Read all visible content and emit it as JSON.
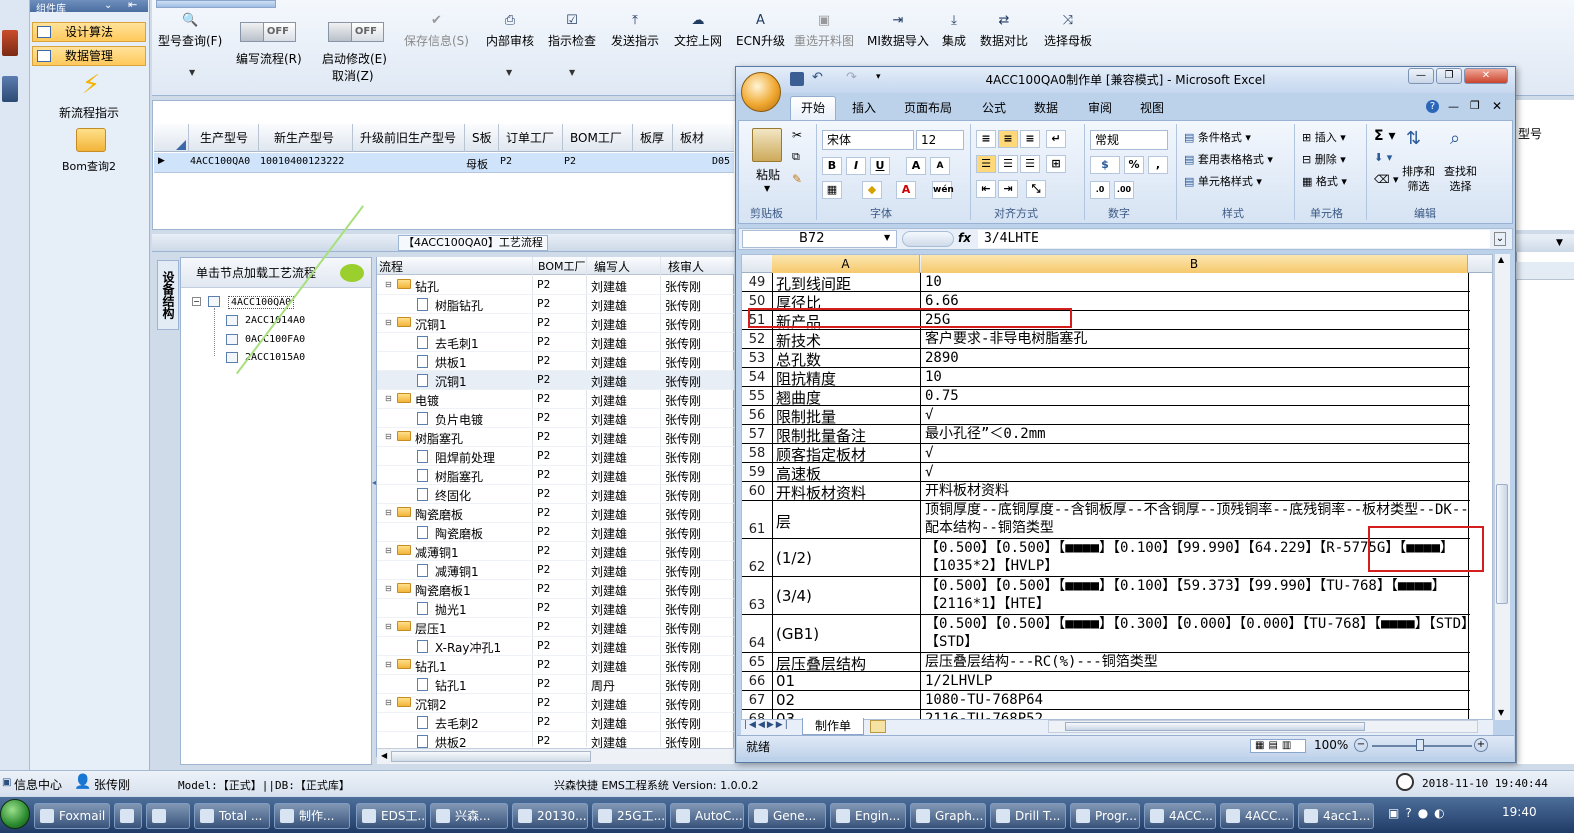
{
  "left_nav": {
    "header": "组件库",
    "items": [
      "设计算法",
      "数据管理"
    ],
    "new_flow": "新流程指示",
    "bom_query": "Bom查询2"
  },
  "toolbar": {
    "model_query": "型号查询(F)",
    "edit_flow": "编写流程(R)",
    "edit_flow_toggle": "OFF",
    "enable_edit": "启动修改(E)",
    "enable_edit_toggle": "OFF",
    "cancel": "取消(Z)",
    "save": "保存信息(S)",
    "internal_review": "内部审核",
    "check": "指示检查",
    "send": "发送指示",
    "upload": "文控上网",
    "ecn": "ECN升级",
    "reissue": "重选开料图",
    "mi_import": "MI数据导入",
    "integrate": "集成",
    "compare": "数据对比",
    "choose_mother": "选择母板"
  },
  "top_grid": {
    "headers": [
      "生产型号",
      "新生产型号",
      "升级前旧生产型号",
      "S板",
      "订单工厂",
      "BOM工厂",
      "板厚",
      "板材"
    ],
    "row": [
      "4ACC100QA0",
      "10010400123222",
      "",
      "母板",
      "P2",
      "P2",
      "",
      "D05"
    ],
    "right_header": "型号"
  },
  "process": {
    "title": "【4ACC100QA0】工艺流程",
    "vtab": "设备结构",
    "tree_header": "单击节点加载工艺流程",
    "tree": {
      "root": "4ACC100QA0",
      "children": [
        "2ACC1014A0",
        "0ACC100FA0",
        "2ACC1015A0"
      ]
    },
    "flow_headers": [
      "流程",
      "BOM工厂",
      "编写人",
      "核审人"
    ],
    "flow_rows": [
      {
        "name": "钻孔",
        "level": 0,
        "bom": "P2",
        "writer": "刘建雄",
        "reviewer": "张传刚"
      },
      {
        "name": "树脂钻孔",
        "level": 1,
        "bom": "P2",
        "writer": "刘建雄",
        "reviewer": "张传刚"
      },
      {
        "name": "沉铜1",
        "level": 0,
        "bom": "P2",
        "writer": "刘建雄",
        "reviewer": "张传刚"
      },
      {
        "name": "去毛刺1",
        "level": 1,
        "bom": "P2",
        "writer": "刘建雄",
        "reviewer": "张传刚"
      },
      {
        "name": "烘板1",
        "level": 1,
        "bom": "P2",
        "writer": "刘建雄",
        "reviewer": "张传刚"
      },
      {
        "name": "沉铜1",
        "level": 1,
        "bom": "P2",
        "writer": "刘建雄",
        "reviewer": "张传刚"
      },
      {
        "name": "电镀",
        "level": 0,
        "bom": "P2",
        "writer": "刘建雄",
        "reviewer": "张传刚"
      },
      {
        "name": "负片电镀",
        "level": 1,
        "bom": "P2",
        "writer": "刘建雄",
        "reviewer": "张传刚"
      },
      {
        "name": "树脂塞孔",
        "level": 0,
        "bom": "P2",
        "writer": "刘建雄",
        "reviewer": "张传刚"
      },
      {
        "name": "阻焊前处理",
        "level": 1,
        "bom": "P2",
        "writer": "刘建雄",
        "reviewer": "张传刚"
      },
      {
        "name": "树脂塞孔",
        "level": 1,
        "bom": "P2",
        "writer": "刘建雄",
        "reviewer": "张传刚"
      },
      {
        "name": "终固化",
        "level": 1,
        "bom": "P2",
        "writer": "刘建雄",
        "reviewer": "张传刚"
      },
      {
        "name": "陶瓷磨板",
        "level": 0,
        "bom": "P2",
        "writer": "刘建雄",
        "reviewer": "张传刚"
      },
      {
        "name": "陶瓷磨板",
        "level": 1,
        "bom": "P2",
        "writer": "刘建雄",
        "reviewer": "张传刚"
      },
      {
        "name": "减薄铜1",
        "level": 0,
        "bom": "P2",
        "writer": "刘建雄",
        "reviewer": "张传刚"
      },
      {
        "name": "减薄铜1",
        "level": 1,
        "bom": "P2",
        "writer": "刘建雄",
        "reviewer": "张传刚"
      },
      {
        "name": "陶瓷磨板1",
        "level": 0,
        "bom": "P2",
        "writer": "刘建雄",
        "reviewer": "张传刚"
      },
      {
        "name": "抛光1",
        "level": 1,
        "bom": "P2",
        "writer": "刘建雄",
        "reviewer": "张传刚"
      },
      {
        "name": "层压1",
        "level": 0,
        "bom": "P2",
        "writer": "刘建雄",
        "reviewer": "张传刚"
      },
      {
        "name": "X-Ray冲孔1",
        "level": 1,
        "bom": "P2",
        "writer": "刘建雄",
        "reviewer": "张传刚"
      },
      {
        "name": "钻孔1",
        "level": 0,
        "bom": "P2",
        "writer": "刘建雄",
        "reviewer": "张传刚"
      },
      {
        "name": "钻孔1",
        "level": 1,
        "bom": "P2",
        "writer": "周丹",
        "reviewer": "张传刚"
      },
      {
        "name": "沉铜2",
        "level": 0,
        "bom": "P2",
        "writer": "刘建雄",
        "reviewer": "张传刚"
      },
      {
        "name": "去毛刺2",
        "level": 1,
        "bom": "P2",
        "writer": "刘建雄",
        "reviewer": "张传刚"
      },
      {
        "name": "烘板2",
        "level": 1,
        "bom": "P2",
        "writer": "刘建雄",
        "reviewer": "张传刚"
      }
    ]
  },
  "excel": {
    "title": "4ACC100QA0制作单 [兼容模式] - Microsoft Excel",
    "tabs": [
      "开始",
      "插入",
      "页面布局",
      "公式",
      "数据",
      "审阅",
      "视图"
    ],
    "ribbon": {
      "paste": "粘贴",
      "font_name": "宋体",
      "font_size": "12",
      "number_format": "常规",
      "cond_format": "条件格式",
      "table_format": "套用表格格式",
      "cell_style": "单元格样式",
      "insert": "插入",
      "delete": "删除",
      "format": "格式",
      "sort_filter": "排序和\n筛选",
      "find_select": "查找和\n选择",
      "groups": [
        "剪贴板",
        "字体",
        "对齐方式",
        "数字",
        "样式",
        "单元格",
        "编辑"
      ]
    },
    "name_box": "B72",
    "formula": "3/4LHTE",
    "col_headers": [
      "A",
      "B"
    ],
    "rows": [
      {
        "n": "49",
        "a": "孔到线间距",
        "b": "10",
        "h": 19
      },
      {
        "n": "50",
        "a": "厚径比",
        "b": "6.66",
        "h": 19
      },
      {
        "n": "51",
        "a": "新产品",
        "b": "25G",
        "h": 19
      },
      {
        "n": "52",
        "a": "新技术",
        "b": "客户要求-非导电树脂塞孔",
        "h": 19
      },
      {
        "n": "53",
        "a": "总孔数",
        "b": "2890",
        "h": 19
      },
      {
        "n": "54",
        "a": "阻抗精度",
        "b": "10",
        "h": 19
      },
      {
        "n": "55",
        "a": "翘曲度",
        "b": "0.75",
        "h": 19
      },
      {
        "n": "56",
        "a": "限制批量",
        "b": "√",
        "h": 19
      },
      {
        "n": "57",
        "a": "限制批量备注",
        "b": "最小孔径”＜0.2mm",
        "h": 19
      },
      {
        "n": "58",
        "a": "顾客指定板材",
        "b": "√",
        "h": 19
      },
      {
        "n": "59",
        "a": "高速板",
        "b": "√",
        "h": 19
      },
      {
        "n": "60",
        "a": "开料板材资料",
        "b": "开料板材资料",
        "h": 19
      },
      {
        "n": "61",
        "a": "层",
        "b": "顶铜厚度--底铜厚度--含铜板厚--不含铜厚--顶残铜率--底残铜率--板材类型--DK--配本结构--铜箔类型",
        "h": 38
      },
      {
        "n": "62",
        "a": "(1/2)",
        "b": "【0.500】【0.500】【■■■■】【0.100】【99.990】【64.229】【R-5775G】【■■■■】【1035*2】【HVLP】",
        "h": 38
      },
      {
        "n": "63",
        "a": "(3/4)",
        "b": "【0.500】【0.500】【■■■■】【0.100】【59.373】【99.990】【TU-768】【■■■■】【2116*1】【HTE】",
        "h": 38
      },
      {
        "n": "64",
        "a": "(GB1)",
        "b": "【0.500】【0.500】【■■■■】【0.300】【0.000】【0.000】【TU-768】【■■■■】【STD】【STD】",
        "h": 38
      },
      {
        "n": "65",
        "a": "层压叠层结构",
        "b": "层压叠层结构---RC(%)---铜箔类型",
        "h": 19
      },
      {
        "n": "66",
        "a": "01",
        "b": "1/2LHVLP",
        "h": 19
      },
      {
        "n": "67",
        "a": "02",
        "b": "1080-TU-768P64",
        "h": 19
      },
      {
        "n": "68",
        "a": "03",
        "b": "2116-TU-768P52",
        "h": 19
      }
    ],
    "sheet_tab": "制作单",
    "status": "就绪",
    "zoom": "100%"
  },
  "status_bar": {
    "info_center": "信息中心",
    "user": "张传刚",
    "model": "Model:【正式】||DB:【正式库】",
    "app": "兴森快捷 EMS工程系统 Version: 1.0.0.2",
    "datetime": "2018-11-10 19:40:44"
  },
  "taskbar": {
    "items": [
      "Foxmail",
      "",
      "",
      "Total ...",
      "制作...",
      "EDS工...",
      "兴森...",
      "20130...",
      "25G工...",
      "AutoC...",
      "Gene...",
      "Engin...",
      "Graph...",
      "Drill T...",
      "Progr...",
      "4ACC...",
      "4ACC...",
      "4acc1..."
    ],
    "clock": "19:40"
  }
}
